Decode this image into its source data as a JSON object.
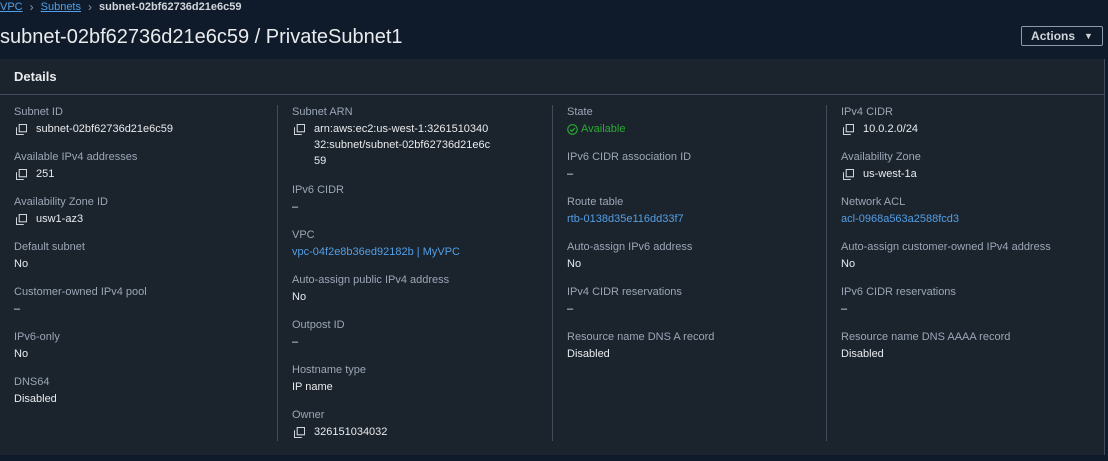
{
  "breadcrumb": {
    "vpc": "VPC",
    "subnets": "Subnets",
    "current": "subnet-02bf62736d21e6c59"
  },
  "header": {
    "title": "subnet-02bf62736d21e6c59 / PrivateSubnet1",
    "actions_label": "Actions"
  },
  "details": {
    "heading": "Details",
    "col1": [
      {
        "label": "Subnet ID",
        "value": "subnet-02bf62736d21e6c59",
        "copy": true
      },
      {
        "label": "Available IPv4 addresses",
        "value": "251",
        "copy": true
      },
      {
        "label": "Availability Zone ID",
        "value": "usw1-az3",
        "copy": true
      },
      {
        "label": "Default subnet",
        "value": "No"
      },
      {
        "label": "Customer-owned IPv4 pool",
        "value": "–"
      },
      {
        "label": "IPv6-only",
        "value": "No"
      },
      {
        "label": "DNS64",
        "value": "Disabled"
      }
    ],
    "col2": [
      {
        "label": "Subnet ARN",
        "value": "arn:aws:ec2:us-west-1:326151034032:subnet/subnet-02bf62736d21e6c59",
        "copy": true
      },
      {
        "label": "IPv6 CIDR",
        "value": "–"
      },
      {
        "label": "VPC",
        "value": "vpc-04f2e8b36ed92182b | MyVPC",
        "link": true
      },
      {
        "label": "Auto-assign public IPv4 address",
        "value": "No"
      },
      {
        "label": "Outpost ID",
        "value": "–"
      },
      {
        "label": "Hostname type",
        "value": "IP name"
      },
      {
        "label": "Owner",
        "value": "326151034032",
        "copy": true
      }
    ],
    "col3": [
      {
        "label": "State",
        "value": "Available",
        "status": true
      },
      {
        "label": "IPv6 CIDR association ID",
        "value": "–"
      },
      {
        "label": "Route table",
        "value": "rtb-0138d35e116dd33f7",
        "link": true
      },
      {
        "label": "Auto-assign IPv6 address",
        "value": "No"
      },
      {
        "label": "IPv4 CIDR reservations",
        "value": "–"
      },
      {
        "label": "Resource name DNS A record",
        "value": "Disabled"
      }
    ],
    "col4": [
      {
        "label": "IPv4 CIDR",
        "value": "10.0.2.0/24",
        "copy": true
      },
      {
        "label": "Availability Zone",
        "value": "us-west-1a",
        "copy": true
      },
      {
        "label": "Network ACL",
        "value": "acl-0968a563a2588fcd3",
        "link": true
      },
      {
        "label": "Auto-assign customer-owned IPv4 address",
        "value": "No"
      },
      {
        "label": "IPv6 CIDR reservations",
        "value": "–"
      },
      {
        "label": "Resource name DNS AAAA record",
        "value": "Disabled"
      }
    ]
  },
  "colors": {
    "link": "#539fe5",
    "success": "#29ad32",
    "panel_bg": "#1b232d",
    "page_bg": "#0f1b2a"
  }
}
